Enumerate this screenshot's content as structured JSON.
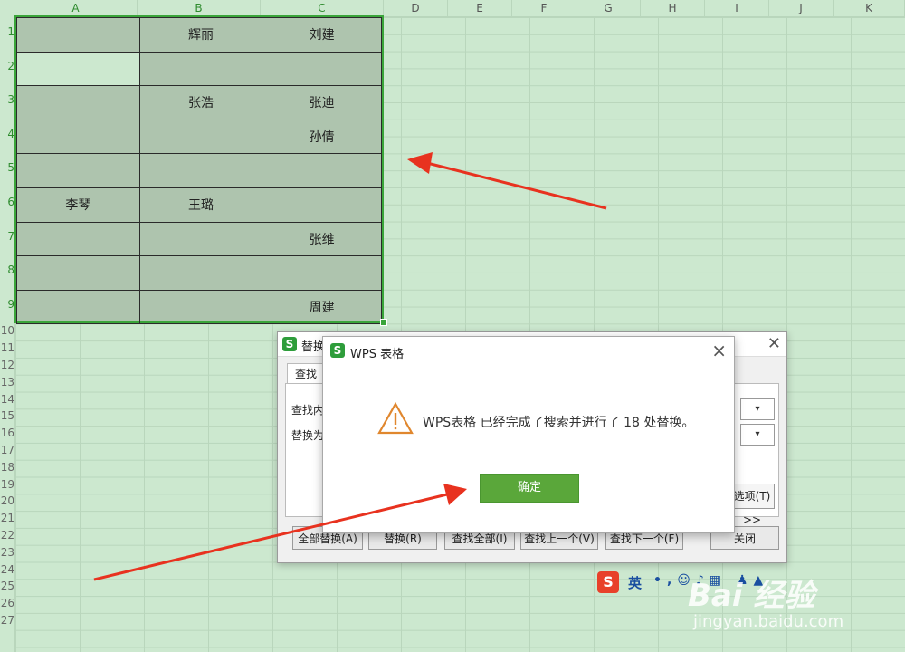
{
  "sheet": {
    "columns": [
      "A",
      "B",
      "C",
      "D",
      "E",
      "F",
      "G",
      "H",
      "I",
      "J",
      "K"
    ],
    "rows": [
      "1",
      "2",
      "3",
      "4",
      "5",
      "6",
      "7",
      "8",
      "9",
      "10",
      "11",
      "12",
      "13",
      "14",
      "15",
      "16",
      "17",
      "18",
      "19",
      "20",
      "21",
      "22",
      "23",
      "24",
      "25",
      "26",
      "27"
    ],
    "cells": [
      [
        "",
        "辉丽",
        "刘建"
      ],
      [
        "",
        "",
        ""
      ],
      [
        "",
        "张浩",
        "张迪"
      ],
      [
        "",
        "",
        "孙倩"
      ],
      [
        "",
        "",
        ""
      ],
      [
        "李琴",
        "王璐",
        ""
      ],
      [
        "",
        "",
        "张维"
      ],
      [
        "",
        "",
        ""
      ],
      [
        "",
        "",
        "周建"
      ]
    ]
  },
  "replace_dialog": {
    "title": "替换",
    "tab_label": "查找(D)",
    "find_label": "查找内容(N):",
    "replace_label": "替换为(E):",
    "options_label": "选项(T) >>",
    "buttons": {
      "replace_all": "全部替换(A)",
      "replace": "替换(R)",
      "find_all": "查找全部(I)",
      "find_prev": "查找上一个(V)",
      "find_next": "查找下一个(F)",
      "close": "关闭"
    }
  },
  "message_box": {
    "title": "WPS 表格",
    "message": "WPS表格 已经完成了搜索并进行了 18 处替换。",
    "ok_label": "确定"
  },
  "ime_toolbar": {
    "logo": "S",
    "language": "英",
    "icons": "•,☺♪▦ ♟▲"
  },
  "watermark": {
    "brand": "Bai 经验",
    "url": "jingyan.baidu.com"
  },
  "colors": {
    "sheet_background": "#cce8cf",
    "range_fill": "#aec4ae",
    "selection_border": "#3aa53a",
    "ok_button": "#5aa73a",
    "arrow": "#e8321f"
  }
}
